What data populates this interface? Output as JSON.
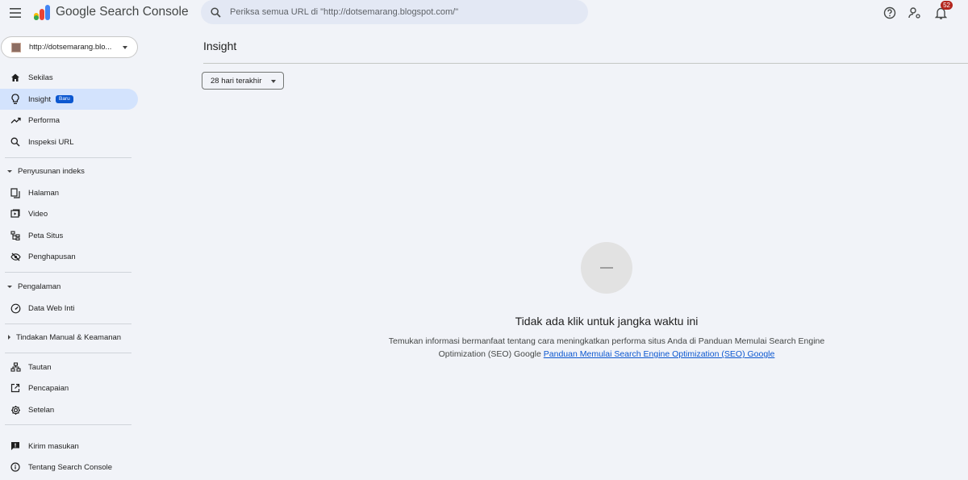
{
  "app": {
    "title": "Google Search Console"
  },
  "search": {
    "placeholder": "Periksa semua URL di \"http://dotsemarang.blogspot.com/\""
  },
  "notifications": {
    "count": "52"
  },
  "property": {
    "label": "http://dotsemarang.blo..."
  },
  "sidebar": {
    "items": [
      {
        "label": "Sekilas",
        "icon": "home-icon"
      },
      {
        "label": "Insight",
        "icon": "lightbulb-icon",
        "badge": "Baru",
        "active": true
      },
      {
        "label": "Performa",
        "icon": "trending-icon"
      },
      {
        "label": "Inspeksi URL",
        "icon": "search-icon"
      }
    ],
    "sections": [
      {
        "label": "Penyusunan indeks",
        "expanded": true,
        "items": [
          {
            "label": "Halaman",
            "icon": "pages-icon"
          },
          {
            "label": "Video",
            "icon": "video-icon"
          },
          {
            "label": "Peta Situs",
            "icon": "sitemap-icon"
          },
          {
            "label": "Penghapusan",
            "icon": "removal-icon"
          }
        ]
      },
      {
        "label": "Pengalaman",
        "expanded": true,
        "items": [
          {
            "label": "Data Web Inti",
            "icon": "speedometer-icon"
          }
        ]
      },
      {
        "label": "Tindakan Manual & Keamanan",
        "expanded": false,
        "items": []
      }
    ],
    "bottom_items": [
      {
        "label": "Tautan",
        "icon": "links-icon"
      },
      {
        "label": "Pencapaian",
        "icon": "achievements-icon"
      },
      {
        "label": "Setelan",
        "icon": "settings-icon"
      }
    ],
    "footer_items": [
      {
        "label": "Kirim masukan",
        "icon": "feedback-icon"
      },
      {
        "label": "Tentang Search Console",
        "icon": "info-icon"
      }
    ]
  },
  "main": {
    "title": "Insight",
    "date_filter": "28 hari terakhir",
    "empty": {
      "title": "Tidak ada klik untuk jangka waktu ini",
      "description": "Temukan informasi bermanfaat tentang cara meningkatkan performa situs Anda di Panduan Memulai Search Engine Optimization (SEO) Google",
      "link": "Panduan Memulai Search Engine Optimization (SEO) Google"
    }
  },
  "colors": {
    "accent": "#0b57d0",
    "active_bg": "#d3e3fd",
    "background": "#f1f3f8",
    "badge_red": "#b3261e"
  }
}
